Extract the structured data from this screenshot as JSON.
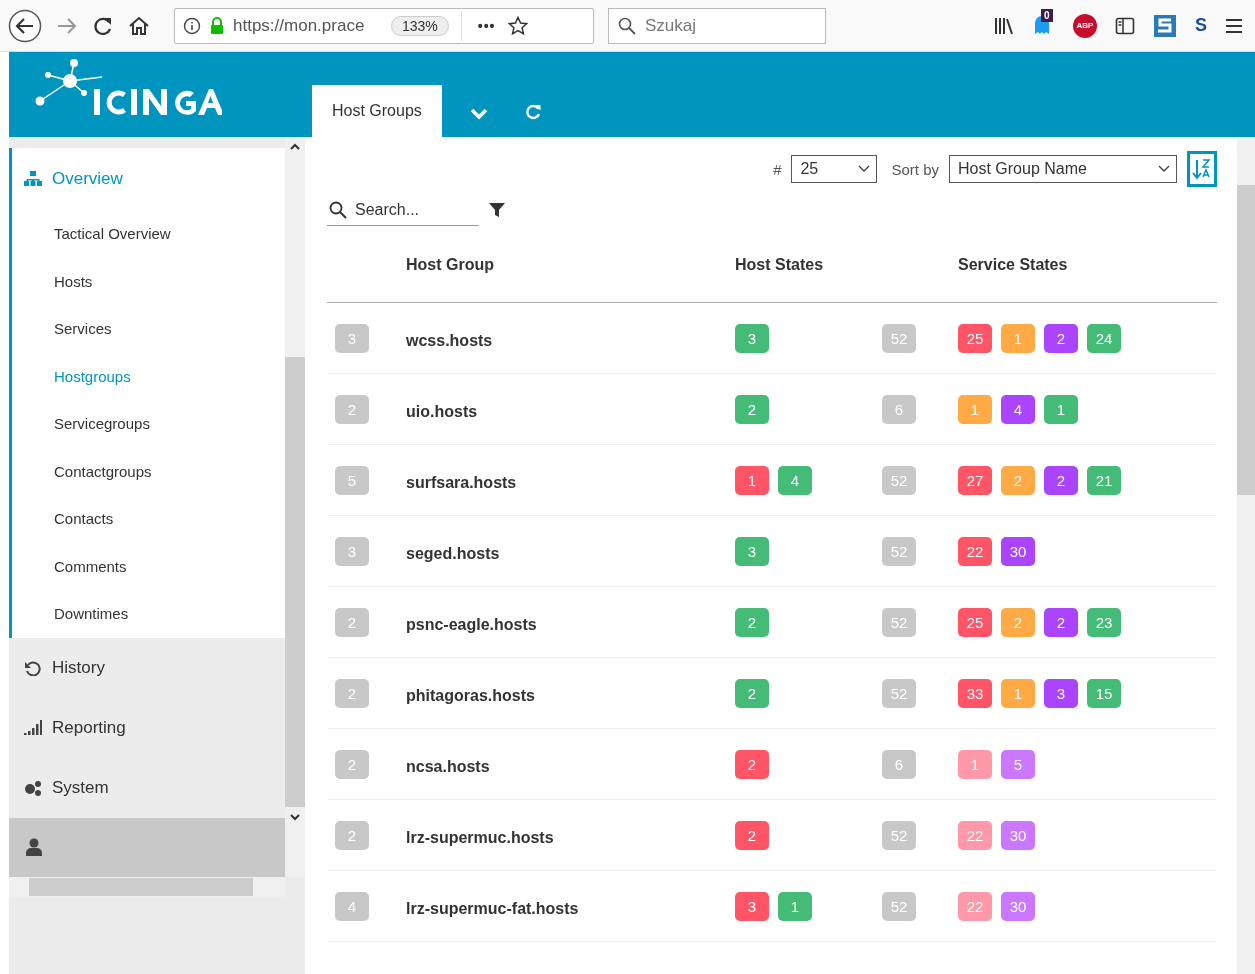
{
  "browser": {
    "url": "https://mon.prace",
    "zoom": "133%",
    "more": "•••",
    "search_placeholder": "Szukaj",
    "ghost_badge": "0",
    "abp_label": "ABP",
    "s_label": "S"
  },
  "header": {
    "tabs": [
      {
        "label": "Host Groups",
        "selected": true
      }
    ]
  },
  "sidebar": {
    "sections": [
      {
        "label": "Overview",
        "expanded": true,
        "children": [
          {
            "label": "Tactical Overview",
            "selected": false
          },
          {
            "label": "Hosts",
            "selected": false
          },
          {
            "label": "Services",
            "selected": false
          },
          {
            "label": "Hostgroups",
            "selected": true
          },
          {
            "label": "Servicegroups",
            "selected": false
          },
          {
            "label": "Contactgroups",
            "selected": false
          },
          {
            "label": "Contacts",
            "selected": false
          },
          {
            "label": "Comments",
            "selected": false
          },
          {
            "label": "Downtimes",
            "selected": false
          }
        ]
      },
      {
        "label": "History",
        "expanded": false
      },
      {
        "label": "Reporting",
        "expanded": false
      },
      {
        "label": "System",
        "expanded": false
      }
    ]
  },
  "controls": {
    "limit_label": "#",
    "limit": "25",
    "sort_label": "Sort by",
    "sort": "Host Group Name",
    "search_placeholder": "Search..."
  },
  "table": {
    "columns": [
      "Host Group",
      "Host States",
      "Service States"
    ],
    "rows": [
      {
        "count": "3",
        "name": "wcss.hosts",
        "host_states": [
          {
            "text": "3",
            "color": "#44bb77"
          }
        ],
        "services_total": "52",
        "service_states": [
          {
            "text": "25",
            "color": "#ff5566"
          },
          {
            "text": "1",
            "color": "#ffaa44"
          },
          {
            "text": "2",
            "color": "#aa44ff"
          },
          {
            "text": "24",
            "color": "#44bb77"
          }
        ]
      },
      {
        "count": "2",
        "name": "uio.hosts",
        "host_states": [
          {
            "text": "2",
            "color": "#44bb77"
          }
        ],
        "services_total": "6",
        "service_states": [
          {
            "text": "1",
            "color": "#ffaa44"
          },
          {
            "text": "4",
            "color": "#aa44ff"
          },
          {
            "text": "1",
            "color": "#44bb77"
          }
        ]
      },
      {
        "count": "5",
        "name": "surfsara.hosts",
        "host_states": [
          {
            "text": "1",
            "color": "#ff5566"
          },
          {
            "text": "4",
            "color": "#44bb77"
          }
        ],
        "services_total": "52",
        "service_states": [
          {
            "text": "27",
            "color": "#ff5566"
          },
          {
            "text": "2",
            "color": "#ffaa44"
          },
          {
            "text": "2",
            "color": "#aa44ff"
          },
          {
            "text": "21",
            "color": "#44bb77"
          }
        ]
      },
      {
        "count": "3",
        "name": "seged.hosts",
        "host_states": [
          {
            "text": "3",
            "color": "#44bb77"
          }
        ],
        "services_total": "52",
        "service_states": [
          {
            "text": "22",
            "color": "#ff5566"
          },
          {
            "text": "30",
            "color": "#aa44ff"
          }
        ]
      },
      {
        "count": "2",
        "name": "psnc-eagle.hosts",
        "host_states": [
          {
            "text": "2",
            "color": "#44bb77"
          }
        ],
        "services_total": "52",
        "service_states": [
          {
            "text": "25",
            "color": "#ff5566"
          },
          {
            "text": "2",
            "color": "#ffaa44"
          },
          {
            "text": "2",
            "color": "#aa44ff"
          },
          {
            "text": "23",
            "color": "#44bb77"
          }
        ]
      },
      {
        "count": "2",
        "name": "phitagoras.hosts",
        "host_states": [
          {
            "text": "2",
            "color": "#44bb77"
          }
        ],
        "services_total": "52",
        "service_states": [
          {
            "text": "33",
            "color": "#ff5566"
          },
          {
            "text": "1",
            "color": "#ffaa44"
          },
          {
            "text": "3",
            "color": "#aa44ff"
          },
          {
            "text": "15",
            "color": "#44bb77"
          }
        ]
      },
      {
        "count": "2",
        "name": "ncsa.hosts",
        "host_states": [
          {
            "text": "2",
            "color": "#ff5566"
          }
        ],
        "services_total": "6",
        "service_states": [
          {
            "text": "1",
            "color": "#ff99aa"
          },
          {
            "text": "5",
            "color": "#cc77ff"
          }
        ]
      },
      {
        "count": "2",
        "name": "lrz-supermuc.hosts",
        "host_states": [
          {
            "text": "2",
            "color": "#ff5566"
          }
        ],
        "services_total": "52",
        "service_states": [
          {
            "text": "22",
            "color": "#ff99aa"
          },
          {
            "text": "30",
            "color": "#cc77ff"
          }
        ]
      },
      {
        "count": "4",
        "name": "lrz-supermuc-fat.hosts",
        "host_states": [
          {
            "text": "3",
            "color": "#ff5566"
          },
          {
            "text": "1",
            "color": "#44bb77"
          }
        ],
        "services_total": "52",
        "service_states": [
          {
            "text": "22",
            "color": "#ff99aa"
          },
          {
            "text": "30",
            "color": "#cc77ff"
          }
        ]
      }
    ]
  }
}
